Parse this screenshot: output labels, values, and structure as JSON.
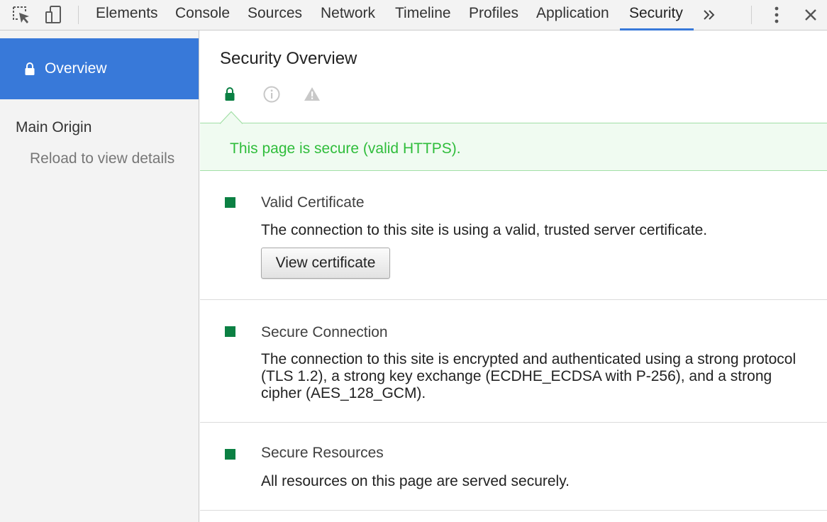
{
  "toolbar": {
    "tabs": [
      "Elements",
      "Console",
      "Sources",
      "Network",
      "Timeline",
      "Profiles",
      "Application",
      "Security"
    ],
    "selected_tab": "Security",
    "more_icon": "double-chevron-right-icon",
    "accent": "#3879d9"
  },
  "sidebar": {
    "overview_label": "Overview",
    "main_origin_label": "Main Origin",
    "reload_text": "Reload to view details"
  },
  "main": {
    "title": "Security Overview",
    "summary_icons": [
      "lock-icon",
      "info-icon",
      "warning-icon"
    ],
    "banner_text": "This page is secure (valid HTTPS).",
    "secure_color": "#0b8043",
    "banner_text_color": "#2fbd3b",
    "sections": [
      {
        "title": "Valid Certificate",
        "description": "The connection to this site is using a valid, trusted server certificate.",
        "button_label": "View certificate"
      },
      {
        "title": "Secure Connection",
        "description": "The connection to this site is encrypted and authenticated using a strong protocol (TLS 1.2), a strong key exchange (ECDHE_ECDSA with P-256), and a strong cipher (AES_128_GCM)."
      },
      {
        "title": "Secure Resources",
        "description": "All resources on this page are served securely."
      }
    ]
  }
}
